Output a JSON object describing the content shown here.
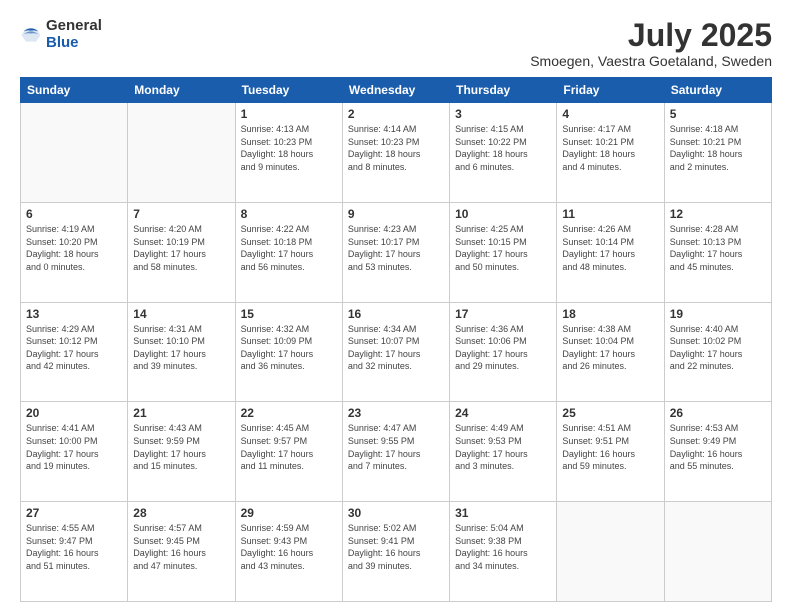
{
  "header": {
    "logo": {
      "general": "General",
      "blue": "Blue"
    },
    "title": "July 2025",
    "location": "Smoegen, Vaestra Goetaland, Sweden"
  },
  "weekdays": [
    "Sunday",
    "Monday",
    "Tuesday",
    "Wednesday",
    "Thursday",
    "Friday",
    "Saturday"
  ],
  "weeks": [
    [
      {
        "day": "",
        "info": ""
      },
      {
        "day": "",
        "info": ""
      },
      {
        "day": "1",
        "info": "Sunrise: 4:13 AM\nSunset: 10:23 PM\nDaylight: 18 hours\nand 9 minutes."
      },
      {
        "day": "2",
        "info": "Sunrise: 4:14 AM\nSunset: 10:23 PM\nDaylight: 18 hours\nand 8 minutes."
      },
      {
        "day": "3",
        "info": "Sunrise: 4:15 AM\nSunset: 10:22 PM\nDaylight: 18 hours\nand 6 minutes."
      },
      {
        "day": "4",
        "info": "Sunrise: 4:17 AM\nSunset: 10:21 PM\nDaylight: 18 hours\nand 4 minutes."
      },
      {
        "day": "5",
        "info": "Sunrise: 4:18 AM\nSunset: 10:21 PM\nDaylight: 18 hours\nand 2 minutes."
      }
    ],
    [
      {
        "day": "6",
        "info": "Sunrise: 4:19 AM\nSunset: 10:20 PM\nDaylight: 18 hours\nand 0 minutes."
      },
      {
        "day": "7",
        "info": "Sunrise: 4:20 AM\nSunset: 10:19 PM\nDaylight: 17 hours\nand 58 minutes."
      },
      {
        "day": "8",
        "info": "Sunrise: 4:22 AM\nSunset: 10:18 PM\nDaylight: 17 hours\nand 56 minutes."
      },
      {
        "day": "9",
        "info": "Sunrise: 4:23 AM\nSunset: 10:17 PM\nDaylight: 17 hours\nand 53 minutes."
      },
      {
        "day": "10",
        "info": "Sunrise: 4:25 AM\nSunset: 10:15 PM\nDaylight: 17 hours\nand 50 minutes."
      },
      {
        "day": "11",
        "info": "Sunrise: 4:26 AM\nSunset: 10:14 PM\nDaylight: 17 hours\nand 48 minutes."
      },
      {
        "day": "12",
        "info": "Sunrise: 4:28 AM\nSunset: 10:13 PM\nDaylight: 17 hours\nand 45 minutes."
      }
    ],
    [
      {
        "day": "13",
        "info": "Sunrise: 4:29 AM\nSunset: 10:12 PM\nDaylight: 17 hours\nand 42 minutes."
      },
      {
        "day": "14",
        "info": "Sunrise: 4:31 AM\nSunset: 10:10 PM\nDaylight: 17 hours\nand 39 minutes."
      },
      {
        "day": "15",
        "info": "Sunrise: 4:32 AM\nSunset: 10:09 PM\nDaylight: 17 hours\nand 36 minutes."
      },
      {
        "day": "16",
        "info": "Sunrise: 4:34 AM\nSunset: 10:07 PM\nDaylight: 17 hours\nand 32 minutes."
      },
      {
        "day": "17",
        "info": "Sunrise: 4:36 AM\nSunset: 10:06 PM\nDaylight: 17 hours\nand 29 minutes."
      },
      {
        "day": "18",
        "info": "Sunrise: 4:38 AM\nSunset: 10:04 PM\nDaylight: 17 hours\nand 26 minutes."
      },
      {
        "day": "19",
        "info": "Sunrise: 4:40 AM\nSunset: 10:02 PM\nDaylight: 17 hours\nand 22 minutes."
      }
    ],
    [
      {
        "day": "20",
        "info": "Sunrise: 4:41 AM\nSunset: 10:00 PM\nDaylight: 17 hours\nand 19 minutes."
      },
      {
        "day": "21",
        "info": "Sunrise: 4:43 AM\nSunset: 9:59 PM\nDaylight: 17 hours\nand 15 minutes."
      },
      {
        "day": "22",
        "info": "Sunrise: 4:45 AM\nSunset: 9:57 PM\nDaylight: 17 hours\nand 11 minutes."
      },
      {
        "day": "23",
        "info": "Sunrise: 4:47 AM\nSunset: 9:55 PM\nDaylight: 17 hours\nand 7 minutes."
      },
      {
        "day": "24",
        "info": "Sunrise: 4:49 AM\nSunset: 9:53 PM\nDaylight: 17 hours\nand 3 minutes."
      },
      {
        "day": "25",
        "info": "Sunrise: 4:51 AM\nSunset: 9:51 PM\nDaylight: 16 hours\nand 59 minutes."
      },
      {
        "day": "26",
        "info": "Sunrise: 4:53 AM\nSunset: 9:49 PM\nDaylight: 16 hours\nand 55 minutes."
      }
    ],
    [
      {
        "day": "27",
        "info": "Sunrise: 4:55 AM\nSunset: 9:47 PM\nDaylight: 16 hours\nand 51 minutes."
      },
      {
        "day": "28",
        "info": "Sunrise: 4:57 AM\nSunset: 9:45 PM\nDaylight: 16 hours\nand 47 minutes."
      },
      {
        "day": "29",
        "info": "Sunrise: 4:59 AM\nSunset: 9:43 PM\nDaylight: 16 hours\nand 43 minutes."
      },
      {
        "day": "30",
        "info": "Sunrise: 5:02 AM\nSunset: 9:41 PM\nDaylight: 16 hours\nand 39 minutes."
      },
      {
        "day": "31",
        "info": "Sunrise: 5:04 AM\nSunset: 9:38 PM\nDaylight: 16 hours\nand 34 minutes."
      },
      {
        "day": "",
        "info": ""
      },
      {
        "day": "",
        "info": ""
      }
    ]
  ]
}
